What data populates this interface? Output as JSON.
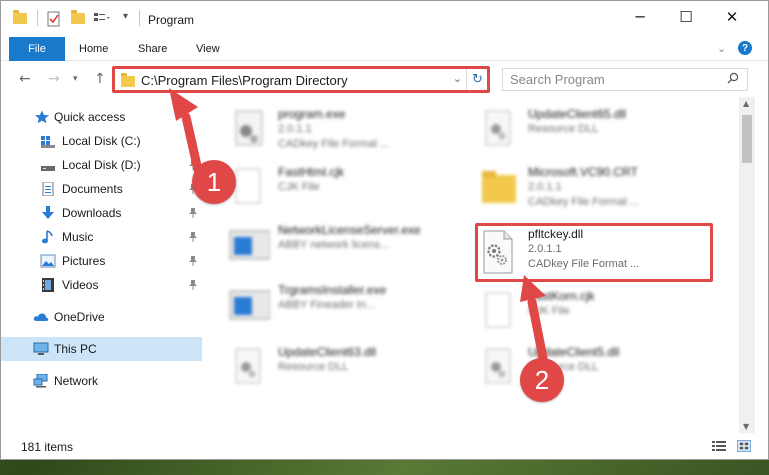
{
  "window": {
    "title": "Program"
  },
  "ribbon": {
    "tabs": [
      "File",
      "Home",
      "Share",
      "View"
    ],
    "help_label": "?"
  },
  "address": {
    "path": "C:\\Program Files\\Program Directory"
  },
  "search": {
    "placeholder": "Search Program"
  },
  "sidebar": {
    "quick_access": "Quick access",
    "items": [
      {
        "label": "Local Disk (C:)",
        "icon": "drive-icon",
        "pinned": true
      },
      {
        "label": "Local Disk (D:)",
        "icon": "drive-icon",
        "pinned": true
      },
      {
        "label": "Documents",
        "icon": "documents-icon",
        "pinned": true
      },
      {
        "label": "Downloads",
        "icon": "downloads-icon",
        "pinned": true
      },
      {
        "label": "Music",
        "icon": "music-icon",
        "pinned": true
      },
      {
        "label": "Pictures",
        "icon": "pictures-icon",
        "pinned": true
      },
      {
        "label": "Videos",
        "icon": "videos-icon",
        "pinned": true
      }
    ],
    "onedrive": "OneDrive",
    "this_pc": "This PC",
    "network": "Network"
  },
  "files": {
    "left": [
      {
        "name": "program.exe",
        "line2": "2.0.1.1",
        "line3": "CADkey File Format ..."
      },
      {
        "name": "FastHtml.cjk",
        "line2": "CJK File",
        "line3": ""
      },
      {
        "name": "NetworkLicenseServer.exe",
        "line2": "ABBY network licens...",
        "line3": ""
      },
      {
        "name": "TrgramsInstaller.exe",
        "line2": "ABBY Fineader In...",
        "line3": ""
      },
      {
        "name": "UpdateClient63.dll",
        "line2": "Resource DLL",
        "line3": ""
      }
    ],
    "right": [
      {
        "name": "UpdateClient65.dll",
        "line2": "Resource DLL",
        "line3": ""
      },
      {
        "name": "Microsoft.VC90.CRT",
        "line2": "2.0.1.1",
        "line3": "CADkey File Format ..."
      },
      {
        "name": "pfltckey.dll",
        "line2": "2.0.1.1",
        "line3": "CADkey File Format ..."
      },
      {
        "name": "FastKorn.cjk",
        "line2": "CJK File",
        "line3": ""
      },
      {
        "name": "UpdateClient5.dll",
        "line2": "Resource DLL",
        "line3": ""
      }
    ]
  },
  "status": {
    "count": "181 items"
  },
  "annotations": {
    "callout_1": "1",
    "callout_2": "2"
  },
  "colors": {
    "accent": "#1979ca",
    "highlight": "#e04848",
    "selected": "#cce4f7"
  }
}
